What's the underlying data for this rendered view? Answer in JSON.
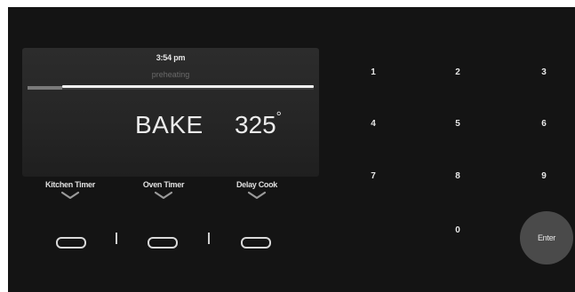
{
  "display": {
    "time": "3:54 pm",
    "status": "preheating",
    "mode": "BAKE",
    "temperature": "325",
    "degree_symbol": "°",
    "preheat_progress": 0.12
  },
  "functions": [
    {
      "label": "Kitchen Timer"
    },
    {
      "label": "Oven Timer"
    },
    {
      "label": "Delay Cook"
    }
  ],
  "keypad": {
    "keys": [
      "1",
      "2",
      "3",
      "4",
      "5",
      "6",
      "7",
      "8",
      "9",
      "0"
    ],
    "enter_label": "Enter"
  },
  "colors": {
    "panel": "#141414",
    "screen": "#2a2a2a",
    "text": "#ececec",
    "enter_button": "#4a4a4a"
  }
}
